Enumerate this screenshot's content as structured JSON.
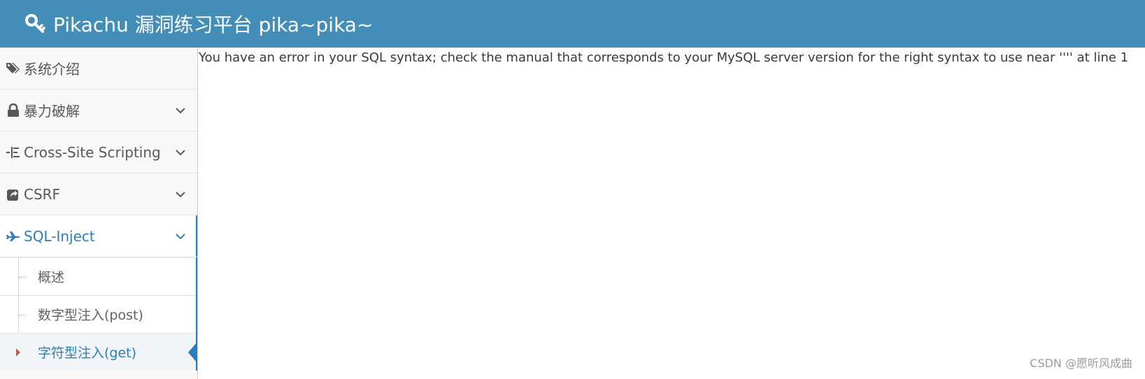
{
  "header": {
    "brand": "Pikachu 漏洞练习平台 pika~pika~",
    "bg_color": "#438eb9",
    "icon": "key-icon"
  },
  "sidebar": {
    "items": [
      {
        "label": "系统介绍",
        "icon": "tags-icon",
        "has_chevron": false
      },
      {
        "label": "暴力破解",
        "icon": "lock-icon",
        "has_chevron": true
      },
      {
        "label": "Cross-Site Scripting",
        "icon": "indent-list-icon",
        "has_chevron": true
      },
      {
        "label": "CSRF",
        "icon": "share-external-icon",
        "has_chevron": true
      },
      {
        "label": "SQL-Inject",
        "icon": "plane-icon",
        "has_chevron": true,
        "open": true
      }
    ],
    "submenu": [
      {
        "label": "概述"
      },
      {
        "label": "数字型注入(post)"
      },
      {
        "label": "字符型注入(get)",
        "active": true
      }
    ],
    "accent_color": "#2b7dbc"
  },
  "content": {
    "message": "You have an error in your SQL syntax; check the manual that corresponds to your MySQL server version for the right syntax to use near '''' at line 1"
  },
  "watermark": {
    "text": "CSDN @愿听风成曲"
  }
}
